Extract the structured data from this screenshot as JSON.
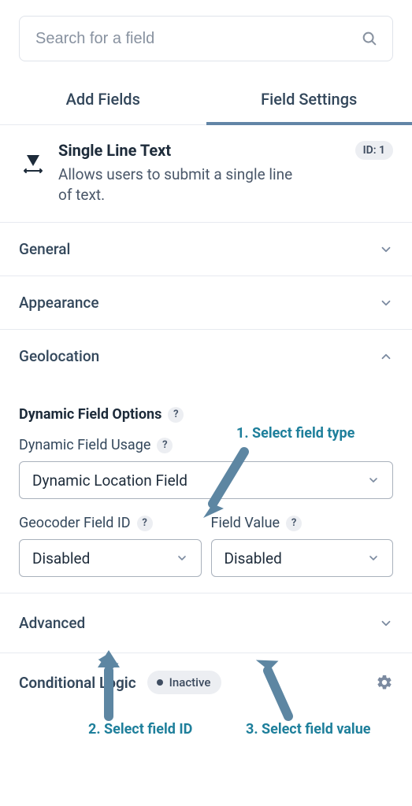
{
  "search": {
    "placeholder": "Search for a field"
  },
  "tabs": {
    "add": "Add Fields",
    "settings": "Field Settings"
  },
  "field": {
    "title": "Single Line Text",
    "desc": "Allows users to submit a single line of text.",
    "id_label": "ID: 1"
  },
  "sections": {
    "general": "General",
    "appearance": "Appearance",
    "geolocation": "Geolocation",
    "advanced": "Advanced",
    "conditional": "Conditional Logic"
  },
  "geo": {
    "group_heading": "Dynamic Field Options",
    "usage_label": "Dynamic Field Usage",
    "usage_value": "Dynamic Location Field",
    "geocoder_label": "Geocoder Field ID",
    "geocoder_value": "Disabled",
    "fieldvalue_label": "Field Value",
    "fieldvalue_value": "Disabled"
  },
  "status": {
    "inactive": "Inactive"
  },
  "help_char": "?",
  "annotations": {
    "a1": "1. Select field type",
    "a2": "2. Select field ID",
    "a3": "3. Select field value"
  },
  "colors": {
    "teal": "#1e7f9b",
    "tab_underline": "#6285a6",
    "arrow": "#5d86a2"
  }
}
